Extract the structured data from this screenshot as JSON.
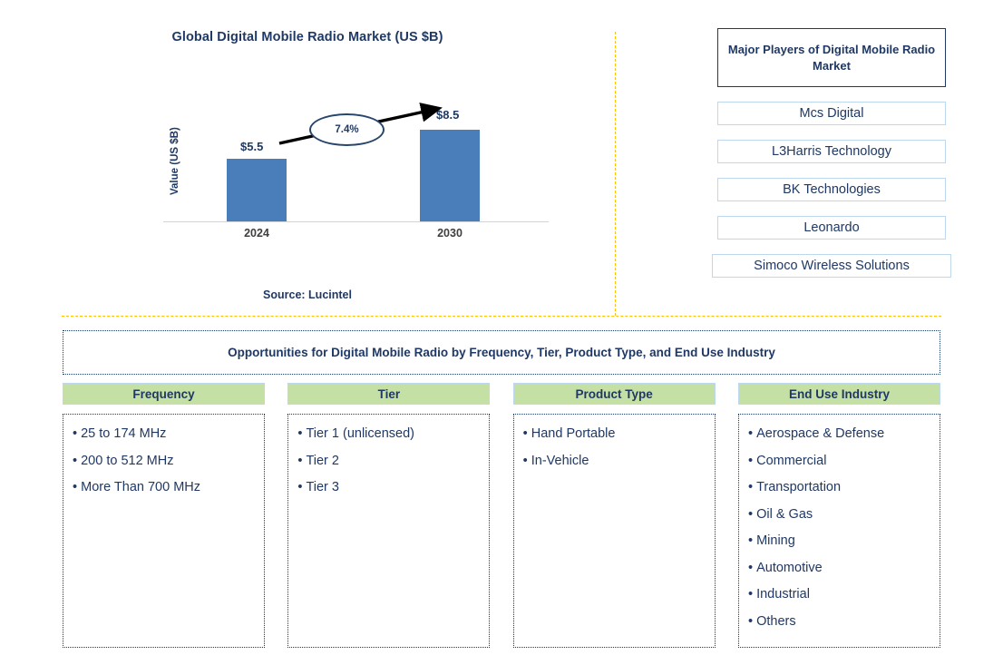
{
  "chart_panel": {
    "title": "Global Digital Mobile Radio Market (US $B)",
    "ylabel": "Value (US $B)",
    "cagr": "7.4%",
    "source": "Source: Lucintel"
  },
  "chart_data": {
    "type": "bar",
    "title": "Global Digital Mobile Radio Market (US $B)",
    "categories": [
      "2024",
      "2030"
    ],
    "values": [
      5.5,
      8.5
    ],
    "data_labels": [
      "$5.5",
      "$8.5"
    ],
    "xlabel": "",
    "ylabel": "Value (US $B)",
    "ylim": [
      0,
      10
    ],
    "grid": false,
    "legend": "none",
    "annotations": [
      {
        "text": "7.4%",
        "type": "cagr-ellipse-with-arrow",
        "from": "2024",
        "to": "2030"
      }
    ],
    "series_color": "#4A7EBB",
    "source": "Source: Lucintel"
  },
  "players": {
    "header": "Major Players of Digital Mobile Radio Market",
    "items": [
      "Mcs Digital",
      "L3Harris Technology",
      "BK Technologies",
      "Leonardo",
      "Simoco Wireless Solutions"
    ]
  },
  "opportunities": {
    "title": "Opportunities for Digital Mobile Radio by Frequency, Tier, Product Type, and End Use Industry",
    "columns": [
      {
        "header": "Frequency",
        "items": [
          "25 to 174 MHz",
          "200 to 512 MHz",
          "More Than 700 MHz"
        ]
      },
      {
        "header": "Tier",
        "items": [
          "Tier 1 (unlicensed)",
          "Tier 2",
          "Tier 3"
        ]
      },
      {
        "header": "Product Type",
        "items": [
          "Hand Portable",
          "In-Vehicle"
        ]
      },
      {
        "header": "End Use Industry",
        "items": [
          "Aerospace & Defense",
          "Commercial",
          "Transportation",
          "Oil & Gas",
          "Mining",
          "Automotive",
          "Industrial",
          "Others"
        ]
      }
    ]
  },
  "colors": {
    "bar": "#4A7EBB",
    "navy": "#1F3864",
    "green_header": "#C5E0A5",
    "orange_divider": "#FFC000",
    "light_blue_border": "#BDD7EE"
  }
}
